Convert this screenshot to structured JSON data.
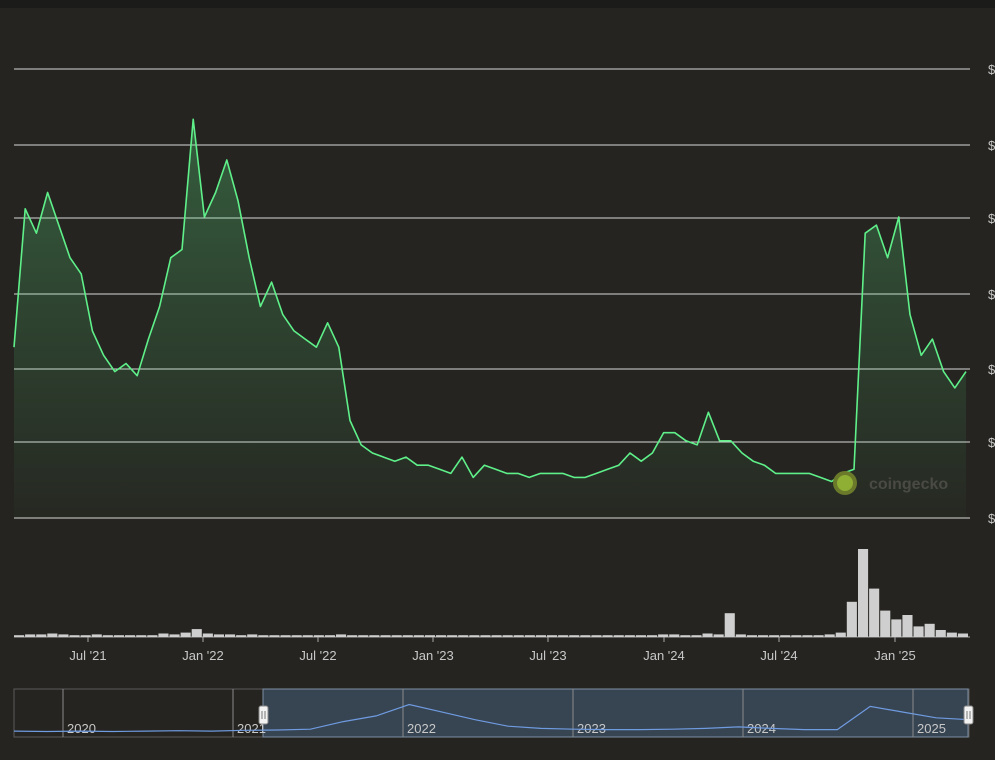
{
  "watermark": "coingecko",
  "y_axis_labels": [
    "$",
    "$",
    "$",
    "$",
    "$",
    "$",
    "$"
  ],
  "colors": {
    "background": "#252420",
    "price_line": "#5ff08a",
    "gridline": "#d8d8d8",
    "volume": "#cfcfcf",
    "navigator_line": "#6f9be0",
    "navigator_window": "#3b4a5c"
  },
  "icons": {
    "watermark_logo": "coingecko-gecko-icon"
  },
  "chart_data": [
    {
      "type": "line",
      "title": "",
      "xlabel": "",
      "ylabel": "",
      "x_tick_labels": [
        "Jul '21",
        "Jan '22",
        "Jul '22",
        "Jan '23",
        "Jul '23",
        "Jan '24",
        "Jul '24",
        "Jan '25"
      ],
      "grid": true,
      "legend": "none",
      "y_scale_note": "axis values not legible",
      "series": [
        {
          "values": [
            [
              0,
              0.4
            ],
            [
              1,
              0.74
            ],
            [
              2,
              0.68
            ],
            [
              3,
              0.78
            ],
            [
              4,
              0.7
            ],
            [
              5,
              0.62
            ],
            [
              6,
              0.58
            ],
            [
              7,
              0.44
            ],
            [
              8,
              0.38
            ],
            [
              9,
              0.34
            ],
            [
              10,
              0.36
            ],
            [
              11,
              0.33
            ],
            [
              12,
              0.42
            ],
            [
              13,
              0.5
            ],
            [
              14,
              0.62
            ],
            [
              15,
              0.64
            ],
            [
              16,
              0.96
            ],
            [
              17,
              0.72
            ],
            [
              18,
              0.78
            ],
            [
              19,
              0.86
            ],
            [
              20,
              0.76
            ],
            [
              21,
              0.62
            ],
            [
              22,
              0.5
            ],
            [
              23,
              0.56
            ],
            [
              24,
              0.48
            ],
            [
              25,
              0.44
            ],
            [
              26,
              0.42
            ],
            [
              27,
              0.4
            ],
            [
              28,
              0.46
            ],
            [
              29,
              0.4
            ],
            [
              30,
              0.22
            ],
            [
              31,
              0.16
            ],
            [
              32,
              0.14
            ],
            [
              33,
              0.13
            ],
            [
              34,
              0.12
            ],
            [
              35,
              0.13
            ],
            [
              36,
              0.11
            ],
            [
              37,
              0.11
            ],
            [
              38,
              0.1
            ],
            [
              39,
              0.09
            ],
            [
              40,
              0.13
            ],
            [
              41,
              0.08
            ],
            [
              42,
              0.11
            ],
            [
              43,
              0.1
            ],
            [
              44,
              0.09
            ],
            [
              45,
              0.09
            ],
            [
              46,
              0.08
            ],
            [
              47,
              0.09
            ],
            [
              48,
              0.09
            ],
            [
              49,
              0.09
            ],
            [
              50,
              0.08
            ],
            [
              51,
              0.08
            ],
            [
              52,
              0.09
            ],
            [
              53,
              0.1
            ],
            [
              54,
              0.11
            ],
            [
              55,
              0.14
            ],
            [
              56,
              0.12
            ],
            [
              57,
              0.14
            ],
            [
              58,
              0.19
            ],
            [
              59,
              0.19
            ],
            [
              60,
              0.17
            ],
            [
              61,
              0.16
            ],
            [
              62,
              0.24
            ],
            [
              63,
              0.17
            ],
            [
              64,
              0.17
            ],
            [
              65,
              0.14
            ],
            [
              66,
              0.12
            ],
            [
              67,
              0.11
            ],
            [
              68,
              0.09
            ],
            [
              69,
              0.09
            ],
            [
              70,
              0.09
            ],
            [
              71,
              0.09
            ],
            [
              72,
              0.08
            ],
            [
              73,
              0.07
            ],
            [
              74,
              0.09
            ],
            [
              75,
              0.1
            ],
            [
              76,
              0.68
            ],
            [
              77,
              0.7
            ],
            [
              78,
              0.62
            ],
            [
              79,
              0.72
            ],
            [
              80,
              0.48
            ],
            [
              81,
              0.38
            ],
            [
              82,
              0.42
            ],
            [
              83,
              0.34
            ],
            [
              84,
              0.3
            ],
            [
              85,
              0.34
            ]
          ]
        }
      ],
      "volume_values": [
        0.02,
        0.03,
        0.03,
        0.04,
        0.03,
        0.02,
        0.02,
        0.03,
        0.02,
        0.02,
        0.02,
        0.02,
        0.02,
        0.04,
        0.03,
        0.05,
        0.09,
        0.04,
        0.03,
        0.03,
        0.02,
        0.03,
        0.02,
        0.02,
        0.02,
        0.02,
        0.02,
        0.02,
        0.02,
        0.03,
        0.02,
        0.02,
        0.02,
        0.02,
        0.02,
        0.02,
        0.02,
        0.02,
        0.02,
        0.02,
        0.02,
        0.02,
        0.02,
        0.02,
        0.02,
        0.02,
        0.02,
        0.02,
        0.02,
        0.02,
        0.02,
        0.02,
        0.02,
        0.02,
        0.02,
        0.02,
        0.02,
        0.02,
        0.03,
        0.03,
        0.02,
        0.02,
        0.04,
        0.03,
        0.27,
        0.03,
        0.02,
        0.02,
        0.02,
        0.02,
        0.02,
        0.02,
        0.02,
        0.03,
        0.05,
        0.4,
        1.0,
        0.55,
        0.3,
        0.2,
        0.25,
        0.12,
        0.15,
        0.08,
        0.05,
        0.04
      ]
    },
    {
      "type": "area",
      "title": "",
      "x_tick_labels": [
        "2020",
        "2021",
        "2022",
        "2023",
        "2024",
        "2025"
      ],
      "selected_range": "Apr '21 – Mar '25",
      "series": [
        {
          "values": [
            0.05,
            0.04,
            0.05,
            0.04,
            0.05,
            0.06,
            0.05,
            0.07,
            0.08,
            0.1,
            0.3,
            0.45,
            0.75,
            0.55,
            0.35,
            0.18,
            0.12,
            0.1,
            0.09,
            0.09,
            0.1,
            0.12,
            0.16,
            0.12,
            0.09,
            0.09,
            0.7,
            0.55,
            0.4,
            0.35
          ]
        }
      ]
    }
  ]
}
